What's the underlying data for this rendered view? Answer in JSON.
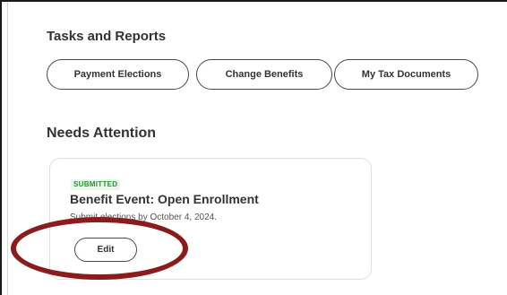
{
  "tasks": {
    "title": "Tasks and Reports",
    "buttons": [
      {
        "label": "Payment Elections"
      },
      {
        "label": "Change Benefits"
      },
      {
        "label": "My Tax Documents"
      }
    ]
  },
  "attention": {
    "title": "Needs Attention",
    "card": {
      "status": "SUBMITTED",
      "title": "Benefit Event: Open Enrollment",
      "subtitle": "Submit elections by October 4, 2024.",
      "edit_label": "Edit"
    }
  },
  "colors": {
    "status_green": "#2f8f3a",
    "status_bg": "#e8f6ea",
    "highlight_ring": "#8a1c1c"
  }
}
